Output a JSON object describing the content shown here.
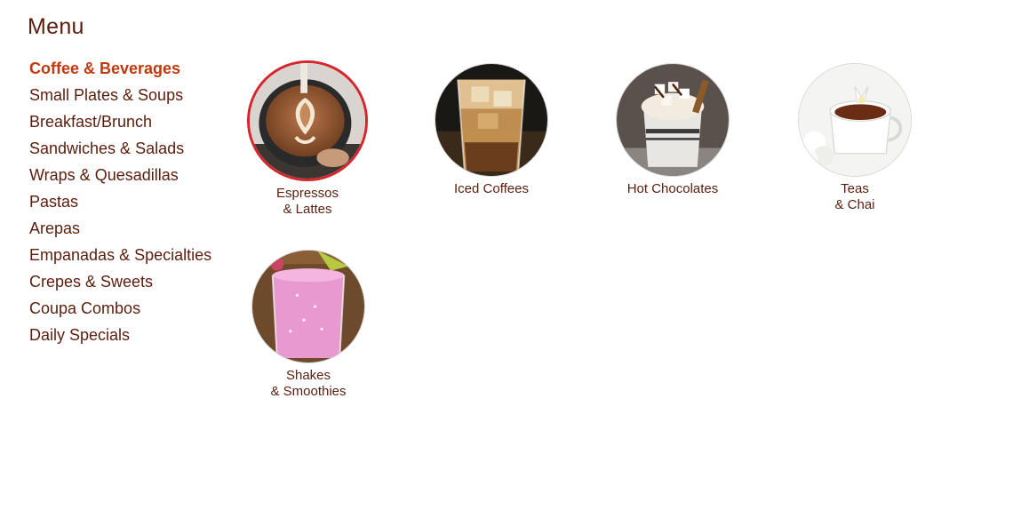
{
  "page": {
    "title": "Menu"
  },
  "sidebar": {
    "items": [
      {
        "label": "Coffee & Beverages",
        "active": true
      },
      {
        "label": "Small Plates & Soups"
      },
      {
        "label": "Breakfast/Brunch"
      },
      {
        "label": "Sandwiches & Salads"
      },
      {
        "label": "Wraps & Quesadillas"
      },
      {
        "label": "Pastas"
      },
      {
        "label": "Arepas"
      },
      {
        "label": "Empanadas & Specialties"
      },
      {
        "label": "Crepes & Sweets"
      },
      {
        "label": "Coupa Combos"
      },
      {
        "label": "Daily Specials"
      }
    ]
  },
  "categories": [
    {
      "line1": "Espressos",
      "line2": "& Lattes",
      "selected": true,
      "image": "latte-art-photo"
    },
    {
      "line1": "Iced Coffees",
      "line2": "",
      "image": "iced-coffee-photo"
    },
    {
      "line1": "Hot Chocolates",
      "line2": "",
      "image": "hot-chocolate-photo"
    },
    {
      "line1": "Teas",
      "line2": "& Chai",
      "image": "tea-cup-photo"
    },
    {
      "line1": "Shakes",
      "line2": "& Smoothies",
      "image": "smoothie-photo"
    }
  ],
  "colors": {
    "text": "#5a1e0e",
    "active": "#c0390f",
    "selected_ring": "#d4262c"
  }
}
